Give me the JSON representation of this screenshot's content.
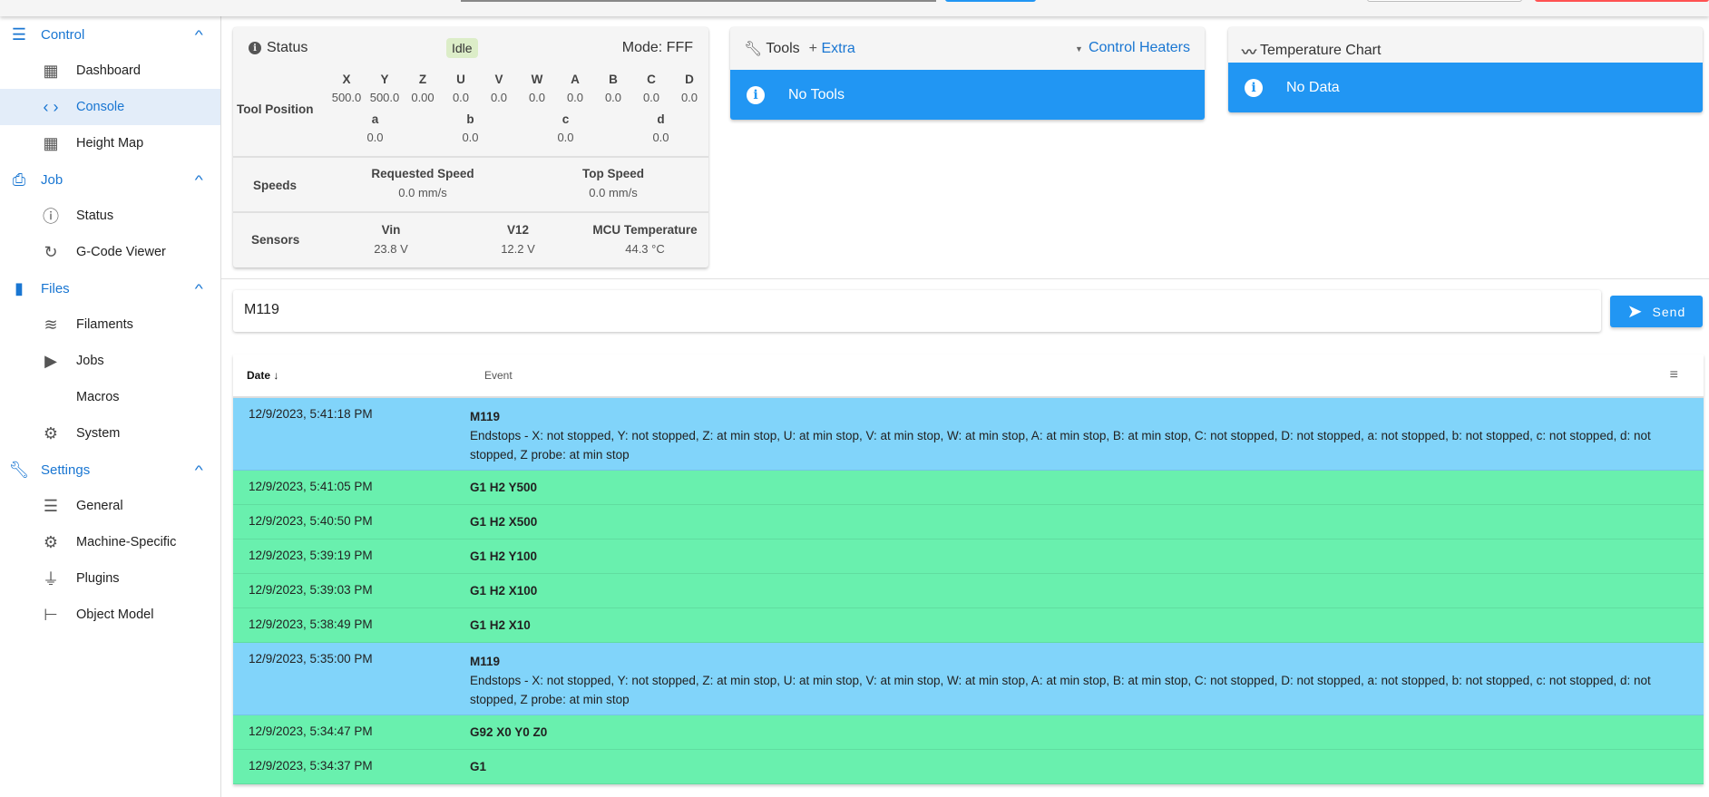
{
  "colors": {
    "accent": "#1976d2",
    "info": "#2196f3",
    "row_info": "#81d4fa",
    "row_success": "#69f0ae",
    "idle_chip": "#dcedc8",
    "danger": "#ff5252"
  },
  "sidebar": {
    "groups": [
      {
        "label": "Control",
        "icon": "tune-icon",
        "items": [
          {
            "label": "Dashboard",
            "icon": "dashboard-icon"
          },
          {
            "label": "Console",
            "icon": "code-icon",
            "active": true
          },
          {
            "label": "Height Map",
            "icon": "grid-icon"
          }
        ]
      },
      {
        "label": "Job",
        "icon": "printer-icon",
        "items": [
          {
            "label": "Status",
            "icon": "info-icon"
          },
          {
            "label": "G-Code Viewer",
            "icon": "3d-rotation-icon"
          }
        ]
      },
      {
        "label": "Files",
        "icon": "sd-card-icon",
        "items": [
          {
            "label": "Filaments",
            "icon": "database-icon"
          },
          {
            "label": "Jobs",
            "icon": "play-icon"
          },
          {
            "label": "Macros",
            "icon": "code-slash-icon"
          },
          {
            "label": "System",
            "icon": "gear-icon"
          }
        ]
      },
      {
        "label": "Settings",
        "icon": "wrench-icon",
        "items": [
          {
            "label": "General",
            "icon": "tune-icon"
          },
          {
            "label": "Machine-Specific",
            "icon": "gears-icon"
          },
          {
            "label": "Plugins",
            "icon": "plug-icon"
          },
          {
            "label": "Object Model",
            "icon": "file-tree-icon"
          }
        ]
      }
    ]
  },
  "status": {
    "title": "Status",
    "state": "Idle",
    "mode": "Mode: FFF",
    "tool_position_label": "Tool Position",
    "axes": [
      [
        "X",
        "500.0"
      ],
      [
        "Y",
        "500.0"
      ],
      [
        "Z",
        "0.00"
      ],
      [
        "U",
        "0.0"
      ],
      [
        "V",
        "0.0"
      ],
      [
        "W",
        "0.0"
      ],
      [
        "A",
        "0.0"
      ],
      [
        "B",
        "0.0"
      ],
      [
        "C",
        "0.0"
      ],
      [
        "D",
        "0.0"
      ]
    ],
    "axes2": [
      [
        "a",
        "0.0"
      ],
      [
        "b",
        "0.0"
      ],
      [
        "c",
        "0.0"
      ],
      [
        "d",
        "0.0"
      ]
    ],
    "speeds_label": "Speeds",
    "requested_speed_label": "Requested Speed",
    "requested_speed": "0.0 mm/s",
    "top_speed_label": "Top Speed",
    "top_speed": "0.0 mm/s",
    "sensors_label": "Sensors",
    "vin_label": "Vin",
    "vin": "23.8 V",
    "v12_label": "V12",
    "v12": "12.2 V",
    "mcu_label": "MCU Temperature",
    "mcu": "44.3 °C"
  },
  "tools": {
    "title": "Tools",
    "extra": "Extra",
    "control_heaters": "Control Heaters",
    "empty": "No Tools"
  },
  "temp_chart": {
    "title": "Temperature Chart",
    "empty": "No Data"
  },
  "console": {
    "input_value": "M119",
    "send_label": "Send"
  },
  "table": {
    "date_header": "Date",
    "event_header": "Event",
    "rows": [
      {
        "date": "12/9/2023, 5:41:18 PM",
        "cmd": "M119",
        "reply": "Endstops - X: not stopped, Y: not stopped, Z: at min stop, U: at min stop, V: at min stop, W: at min stop, A: at min stop, B: at min stop, C: not stopped, D: not stopped, a: not stopped, b: not stopped, c: not stopped, d: not stopped, Z probe: at min stop",
        "type": "info"
      },
      {
        "date": "12/9/2023, 5:41:05 PM",
        "cmd": "G1 H2 Y500",
        "type": "success"
      },
      {
        "date": "12/9/2023, 5:40:50 PM",
        "cmd": "G1 H2 X500",
        "type": "success"
      },
      {
        "date": "12/9/2023, 5:39:19 PM",
        "cmd": "G1 H2 Y100",
        "type": "success"
      },
      {
        "date": "12/9/2023, 5:39:03 PM",
        "cmd": "G1 H2 X100",
        "type": "success"
      },
      {
        "date": "12/9/2023, 5:38:49 PM",
        "cmd": "G1 H2 X10",
        "type": "success"
      },
      {
        "date": "12/9/2023, 5:35:00 PM",
        "cmd": "M119",
        "reply": "Endstops - X: not stopped, Y: not stopped, Z: at min stop, U: at min stop, V: at min stop, W: at min stop, A: at min stop, B: at min stop, C: not stopped, D: not stopped, a: not stopped, b: not stopped, c: not stopped, d: not stopped, Z probe: at min stop",
        "type": "info"
      },
      {
        "date": "12/9/2023, 5:34:47 PM",
        "cmd": "G92 X0 Y0 Z0",
        "type": "success"
      },
      {
        "date": "12/9/2023, 5:34:37 PM",
        "cmd": "G1",
        "type": "success"
      }
    ]
  }
}
